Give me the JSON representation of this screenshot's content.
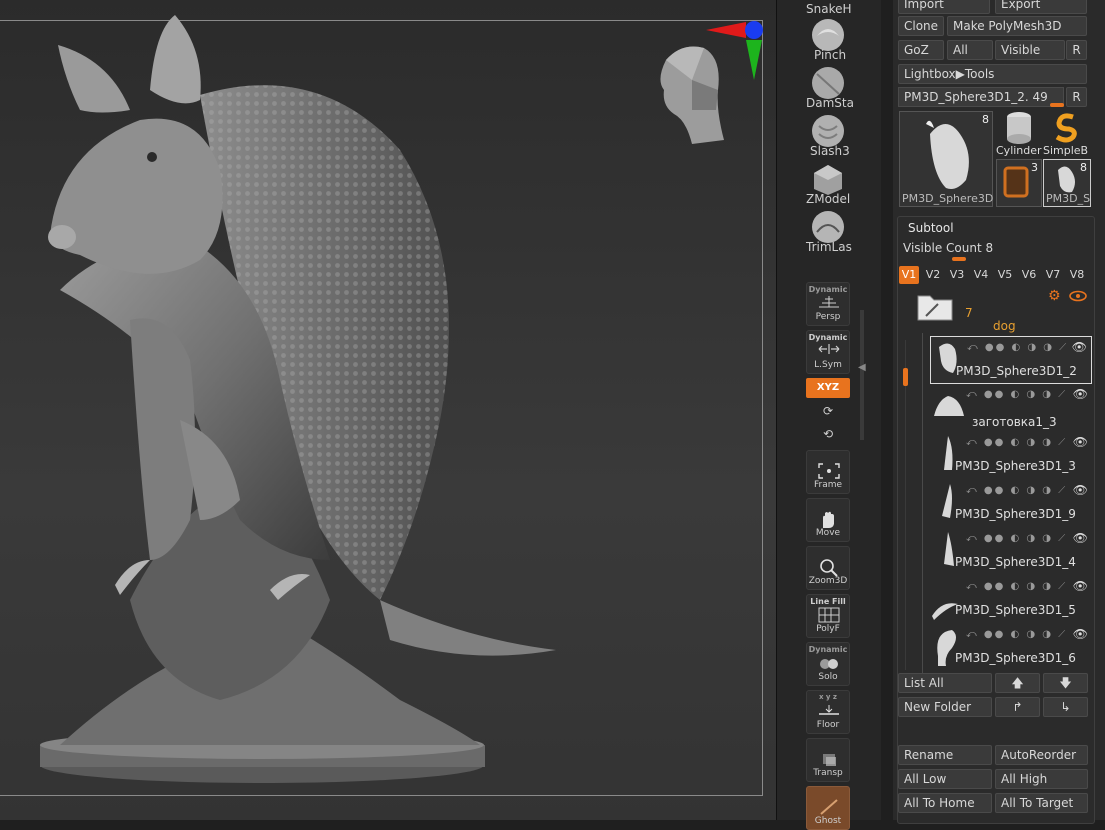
{
  "brushes": [
    {
      "label": "SnakeH",
      "icon": "snakehook-brush-icon"
    },
    {
      "label": "Pinch",
      "icon": "pinch-brush-icon"
    },
    {
      "label": "DamSta",
      "icon": "damstandard-brush-icon"
    },
    {
      "label": "Slash3",
      "icon": "slash3-brush-icon"
    },
    {
      "label": "ZModel",
      "icon": "zmodeler-brush-icon"
    },
    {
      "label": "TrimLas",
      "icon": "trimlasso-brush-icon"
    }
  ],
  "dock": {
    "persp": {
      "top": "Dynamic",
      "label": "Persp"
    },
    "lsym": {
      "top": "Dynamic",
      "label": "L.Sym"
    },
    "xyz": {
      "label": "XYZ"
    },
    "frame": {
      "label": "Frame"
    },
    "move": {
      "label": "Move"
    },
    "zoom3d": {
      "label": "Zoom3D"
    },
    "polyf": {
      "top": "Line Fill",
      "label": "PolyF"
    },
    "solo": {
      "top": "Dynamic",
      "label": "Solo"
    },
    "floor": {
      "top": "x y z",
      "label": "Floor"
    },
    "transp": {
      "label": "Transp"
    },
    "ghost": {
      "label": "Ghost"
    }
  },
  "tool": {
    "import": "Import",
    "export": "Export",
    "clone": "Clone",
    "make_polymesh": "Make PolyMesh3D",
    "goz": "GoZ",
    "all": "All",
    "visible": "Visible",
    "r": "R",
    "lightbox_tools": "Lightbox▶Tools",
    "current_tool": "PM3D_Sphere3D1_2.",
    "current_tool_value": "49",
    "thumbs": [
      {
        "label": "PM3D_Sphere3D",
        "count": "8"
      },
      {
        "label": "Cylinder"
      },
      {
        "label": "SimpleB"
      },
      {
        "label": "",
        "count": "3"
      },
      {
        "label": "PM3D_S",
        "count": "8"
      }
    ]
  },
  "subtool": {
    "title": "Subtool",
    "visible_count_label": "Visible Count",
    "visible_count": "8",
    "visible_count_fraction": 0.4,
    "tabs": [
      "V1",
      "V2",
      "V3",
      "V4",
      "V5",
      "V6",
      "V7",
      "V8"
    ],
    "active_tab": "V1",
    "folder_count": "7",
    "folder_name": "dog",
    "items": [
      {
        "name": "PM3D_Sphere3D1_2",
        "selected": true
      },
      {
        "name": "заготовка1_3",
        "selected": false
      },
      {
        "name": "PM3D_Sphere3D1_3",
        "selected": false
      },
      {
        "name": "PM3D_Sphere3D1_9",
        "selected": false
      },
      {
        "name": "PM3D_Sphere3D1_4",
        "selected": false
      },
      {
        "name": "PM3D_Sphere3D1_5",
        "selected": false
      },
      {
        "name": "PM3D_Sphere3D1_6",
        "selected": false
      }
    ],
    "list_all": "List All",
    "new_folder": "New Folder",
    "rename": "Rename",
    "auto_reorder": "AutoReorder",
    "all_low": "All Low",
    "all_high": "All High",
    "all_to_home": "All To Home",
    "all_to_target": "All To Target"
  },
  "colors": {
    "accent": "#e8731e",
    "panel": "#2a2a2a",
    "canvas": "#333333"
  }
}
